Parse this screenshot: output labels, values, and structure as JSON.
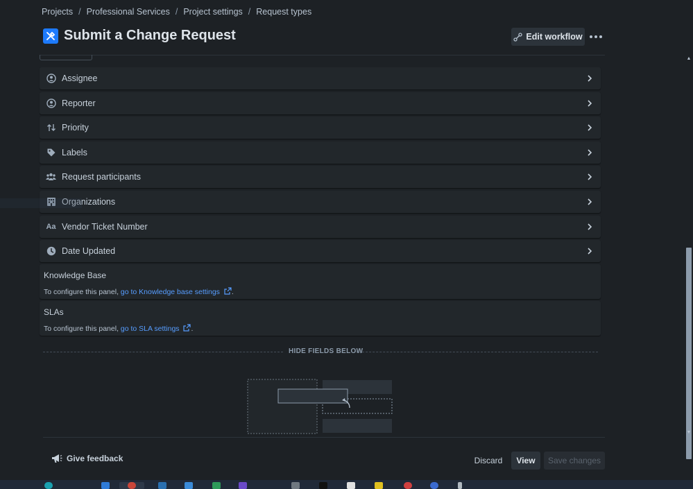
{
  "breadcrumb": {
    "items": [
      "Projects",
      "Professional Services",
      "Project settings",
      "Request types"
    ],
    "separator": "/"
  },
  "page": {
    "title": "Submit a Change Request",
    "icon": "tools-icon"
  },
  "header_actions": {
    "edit_workflow_label": "Edit workflow",
    "more_icon": "more-dots-icon"
  },
  "fields": [
    {
      "label": "Assignee",
      "icon": "user-circle-icon"
    },
    {
      "label": "Reporter",
      "icon": "user-circle-icon"
    },
    {
      "label": "Priority",
      "icon": "priority-arrows-icon"
    },
    {
      "label": "Labels",
      "icon": "tag-icon"
    },
    {
      "label": "Request participants",
      "icon": "people-group-icon"
    },
    {
      "label": "Organizations",
      "icon": "office-building-icon"
    },
    {
      "label": "Vendor Ticket Number",
      "icon": "text-field-icon",
      "icon_text": "Aa"
    },
    {
      "label": "Date Updated",
      "icon": "clock-icon"
    }
  ],
  "panels": {
    "knowledge_base": {
      "title": "Knowledge Base",
      "desc_prefix": "To configure this panel,",
      "link": "go to Knowledge base settings",
      "suffix": "."
    },
    "slas": {
      "title": "SLAs",
      "desc_prefix": "To configure this panel,",
      "link": "go to SLA settings",
      "suffix": "."
    }
  },
  "hide_fields_label": "HIDE FIELDS BELOW",
  "footer": {
    "feedback_label": "Give feedback",
    "discard_label": "Discard",
    "view_label": "View",
    "save_label": "Save changes"
  },
  "colors": {
    "background": "#1d2125",
    "card": "#22272b",
    "link": "#579dff",
    "brand_icon": "#1d7afc"
  }
}
